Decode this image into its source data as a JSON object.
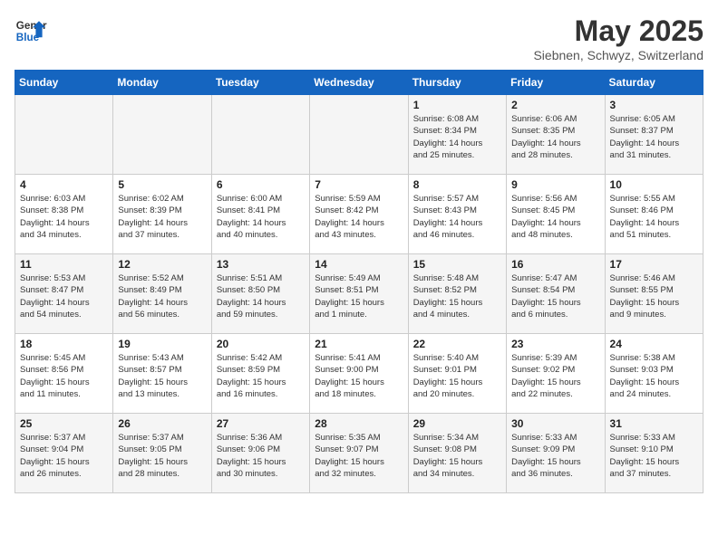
{
  "header": {
    "logo_general": "General",
    "logo_blue": "Blue",
    "title": "May 2025",
    "location": "Siebnen, Schwyz, Switzerland"
  },
  "weekdays": [
    "Sunday",
    "Monday",
    "Tuesday",
    "Wednesday",
    "Thursday",
    "Friday",
    "Saturday"
  ],
  "weeks": [
    [
      {
        "day": "",
        "info": ""
      },
      {
        "day": "",
        "info": ""
      },
      {
        "day": "",
        "info": ""
      },
      {
        "day": "",
        "info": ""
      },
      {
        "day": "1",
        "info": "Sunrise: 6:08 AM\nSunset: 8:34 PM\nDaylight: 14 hours\nand 25 minutes."
      },
      {
        "day": "2",
        "info": "Sunrise: 6:06 AM\nSunset: 8:35 PM\nDaylight: 14 hours\nand 28 minutes."
      },
      {
        "day": "3",
        "info": "Sunrise: 6:05 AM\nSunset: 8:37 PM\nDaylight: 14 hours\nand 31 minutes."
      }
    ],
    [
      {
        "day": "4",
        "info": "Sunrise: 6:03 AM\nSunset: 8:38 PM\nDaylight: 14 hours\nand 34 minutes."
      },
      {
        "day": "5",
        "info": "Sunrise: 6:02 AM\nSunset: 8:39 PM\nDaylight: 14 hours\nand 37 minutes."
      },
      {
        "day": "6",
        "info": "Sunrise: 6:00 AM\nSunset: 8:41 PM\nDaylight: 14 hours\nand 40 minutes."
      },
      {
        "day": "7",
        "info": "Sunrise: 5:59 AM\nSunset: 8:42 PM\nDaylight: 14 hours\nand 43 minutes."
      },
      {
        "day": "8",
        "info": "Sunrise: 5:57 AM\nSunset: 8:43 PM\nDaylight: 14 hours\nand 46 minutes."
      },
      {
        "day": "9",
        "info": "Sunrise: 5:56 AM\nSunset: 8:45 PM\nDaylight: 14 hours\nand 48 minutes."
      },
      {
        "day": "10",
        "info": "Sunrise: 5:55 AM\nSunset: 8:46 PM\nDaylight: 14 hours\nand 51 minutes."
      }
    ],
    [
      {
        "day": "11",
        "info": "Sunrise: 5:53 AM\nSunset: 8:47 PM\nDaylight: 14 hours\nand 54 minutes."
      },
      {
        "day": "12",
        "info": "Sunrise: 5:52 AM\nSunset: 8:49 PM\nDaylight: 14 hours\nand 56 minutes."
      },
      {
        "day": "13",
        "info": "Sunrise: 5:51 AM\nSunset: 8:50 PM\nDaylight: 14 hours\nand 59 minutes."
      },
      {
        "day": "14",
        "info": "Sunrise: 5:49 AM\nSunset: 8:51 PM\nDaylight: 15 hours\nand 1 minute."
      },
      {
        "day": "15",
        "info": "Sunrise: 5:48 AM\nSunset: 8:52 PM\nDaylight: 15 hours\nand 4 minutes."
      },
      {
        "day": "16",
        "info": "Sunrise: 5:47 AM\nSunset: 8:54 PM\nDaylight: 15 hours\nand 6 minutes."
      },
      {
        "day": "17",
        "info": "Sunrise: 5:46 AM\nSunset: 8:55 PM\nDaylight: 15 hours\nand 9 minutes."
      }
    ],
    [
      {
        "day": "18",
        "info": "Sunrise: 5:45 AM\nSunset: 8:56 PM\nDaylight: 15 hours\nand 11 minutes."
      },
      {
        "day": "19",
        "info": "Sunrise: 5:43 AM\nSunset: 8:57 PM\nDaylight: 15 hours\nand 13 minutes."
      },
      {
        "day": "20",
        "info": "Sunrise: 5:42 AM\nSunset: 8:59 PM\nDaylight: 15 hours\nand 16 minutes."
      },
      {
        "day": "21",
        "info": "Sunrise: 5:41 AM\nSunset: 9:00 PM\nDaylight: 15 hours\nand 18 minutes."
      },
      {
        "day": "22",
        "info": "Sunrise: 5:40 AM\nSunset: 9:01 PM\nDaylight: 15 hours\nand 20 minutes."
      },
      {
        "day": "23",
        "info": "Sunrise: 5:39 AM\nSunset: 9:02 PM\nDaylight: 15 hours\nand 22 minutes."
      },
      {
        "day": "24",
        "info": "Sunrise: 5:38 AM\nSunset: 9:03 PM\nDaylight: 15 hours\nand 24 minutes."
      }
    ],
    [
      {
        "day": "25",
        "info": "Sunrise: 5:37 AM\nSunset: 9:04 PM\nDaylight: 15 hours\nand 26 minutes."
      },
      {
        "day": "26",
        "info": "Sunrise: 5:37 AM\nSunset: 9:05 PM\nDaylight: 15 hours\nand 28 minutes."
      },
      {
        "day": "27",
        "info": "Sunrise: 5:36 AM\nSunset: 9:06 PM\nDaylight: 15 hours\nand 30 minutes."
      },
      {
        "day": "28",
        "info": "Sunrise: 5:35 AM\nSunset: 9:07 PM\nDaylight: 15 hours\nand 32 minutes."
      },
      {
        "day": "29",
        "info": "Sunrise: 5:34 AM\nSunset: 9:08 PM\nDaylight: 15 hours\nand 34 minutes."
      },
      {
        "day": "30",
        "info": "Sunrise: 5:33 AM\nSunset: 9:09 PM\nDaylight: 15 hours\nand 36 minutes."
      },
      {
        "day": "31",
        "info": "Sunrise: 5:33 AM\nSunset: 9:10 PM\nDaylight: 15 hours\nand 37 minutes."
      }
    ]
  ]
}
